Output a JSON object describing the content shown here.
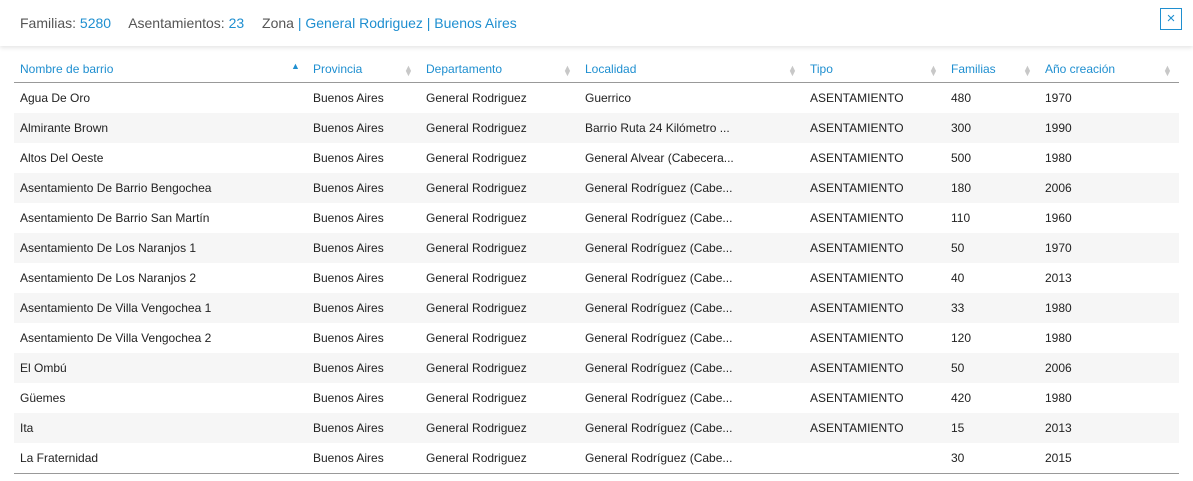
{
  "summary": {
    "familias_label": "Familias:",
    "familias_value": "5280",
    "asentamientos_label": "Asentamientos:",
    "asentamientos_value": "23",
    "zona_label": "Zona",
    "zona_value": "| General Rodriguez | Buenos Aires"
  },
  "close_label": "×",
  "colors": {
    "accent": "#1f8fd0",
    "row_alt": "#f6f6f6"
  },
  "table": {
    "columns": [
      {
        "label": "Nombre de barrio",
        "sort": "ascending"
      },
      {
        "label": "Provincia",
        "sort": "none"
      },
      {
        "label": "Departamento",
        "sort": "none"
      },
      {
        "label": "Localidad",
        "sort": "none"
      },
      {
        "label": "Tipo",
        "sort": "none"
      },
      {
        "label": "Familias",
        "sort": "none"
      },
      {
        "label": "Año creación",
        "sort": "none"
      }
    ],
    "rows": [
      [
        "Agua De Oro",
        "Buenos Aires",
        "General Rodriguez",
        "Guerrico",
        "ASENTAMIENTO",
        "480",
        "1970"
      ],
      [
        "Almirante Brown",
        "Buenos Aires",
        "General Rodriguez",
        "Barrio Ruta 24 Kilómetro ...",
        "ASENTAMIENTO",
        "300",
        "1990"
      ],
      [
        "Altos Del Oeste",
        "Buenos Aires",
        "General Rodriguez",
        "General Alvear (Cabecera...",
        "ASENTAMIENTO",
        "500",
        "1980"
      ],
      [
        "Asentamiento De Barrio Bengochea",
        "Buenos Aires",
        "General Rodriguez",
        "General Rodríguez (Cabe...",
        "ASENTAMIENTO",
        "180",
        "2006"
      ],
      [
        "Asentamiento De Barrio San Martín",
        "Buenos Aires",
        "General Rodriguez",
        "General Rodríguez (Cabe...",
        "ASENTAMIENTO",
        "110",
        "1960"
      ],
      [
        "Asentamiento De Los Naranjos 1",
        "Buenos Aires",
        "General Rodriguez",
        "General Rodríguez (Cabe...",
        "ASENTAMIENTO",
        "50",
        "1970"
      ],
      [
        "Asentamiento De Los Naranjos 2",
        "Buenos Aires",
        "General Rodriguez",
        "General Rodríguez (Cabe...",
        "ASENTAMIENTO",
        "40",
        "2013"
      ],
      [
        "Asentamiento De Villa Vengochea 1",
        "Buenos Aires",
        "General Rodriguez",
        "General Rodríguez (Cabe...",
        "ASENTAMIENTO",
        "33",
        "1980"
      ],
      [
        "Asentamiento De Villa Vengochea 2",
        "Buenos Aires",
        "General Rodriguez",
        "General Rodríguez (Cabe...",
        "ASENTAMIENTO",
        "120",
        "1980"
      ],
      [
        "El Ombú",
        "Buenos Aires",
        "General Rodriguez",
        "General Rodríguez (Cabe...",
        "ASENTAMIENTO",
        "50",
        "2006"
      ],
      [
        "Güemes",
        "Buenos Aires",
        "General Rodriguez",
        "General Rodríguez (Cabe...",
        "ASENTAMIENTO",
        "420",
        "1980"
      ],
      [
        "Ita",
        "Buenos Aires",
        "General Rodriguez",
        "General Rodríguez (Cabe...",
        "ASENTAMIENTO",
        "15",
        "2013"
      ],
      [
        "La Fraternidad",
        "Buenos Aires",
        "General Rodriguez",
        "General Rodríguez (Cabe...",
        "",
        "30",
        "2015"
      ]
    ]
  }
}
